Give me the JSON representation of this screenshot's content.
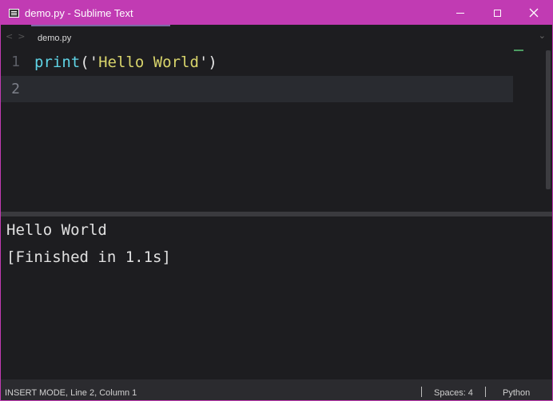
{
  "window": {
    "title": "demo.py - Sublime Text",
    "accent_color": "#c13bb3"
  },
  "tabbar": {
    "nav_back_icon": "chevron-left-icon",
    "nav_forward_icon": "chevron-right-icon",
    "tabs": [
      {
        "label": "demo.py",
        "active": true
      }
    ],
    "dropdown_icon": "chevron-down-icon"
  },
  "editor": {
    "lines": [
      {
        "number": "1",
        "tokens": {
          "func": "print",
          "open_paren": "(",
          "open_quote": "'",
          "string": "Hello World",
          "close_quote": "'",
          "close_paren": ")"
        }
      },
      {
        "number": "2",
        "text": ""
      }
    ],
    "current_line": 2,
    "colors": {
      "function": "#5fd4e6",
      "string": "#d8d46b",
      "current_line_bg": "#292b30"
    }
  },
  "output": {
    "lines": [
      "Hello World",
      "[Finished in 1.1s]"
    ]
  },
  "statusbar": {
    "mode_position": "INSERT MODE, Line 2, Column 1",
    "indentation": "Spaces: 4",
    "syntax": "Python"
  }
}
